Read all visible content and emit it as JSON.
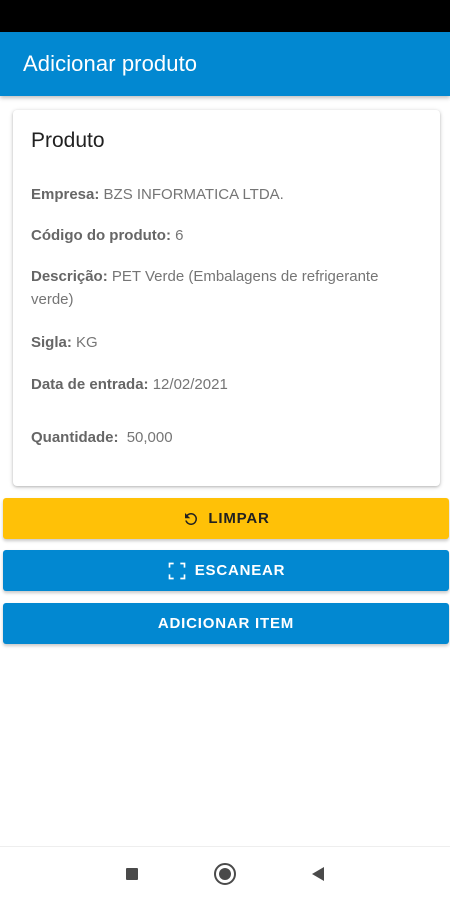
{
  "app_bar": {
    "title": "Adicionar produto"
  },
  "card": {
    "title": "Produto",
    "fields": {
      "empresa": {
        "label": "Empresa:",
        "value": "BZS INFORMATICA LTDA."
      },
      "codigo": {
        "label": "Código do produto:",
        "value": "6"
      },
      "descricao": {
        "label": "Descrição:",
        "value": "PET Verde (Embalagens de refrigerante verde)"
      },
      "sigla": {
        "label": "Sigla:",
        "value": "KG"
      },
      "data_entrada": {
        "label": "Data de entrada:",
        "value": "12/02/2021"
      },
      "quantidade": {
        "label": "Quantidade:",
        "value": "50,000"
      }
    }
  },
  "buttons": {
    "clear": {
      "label": "LIMPAR",
      "icon": "refresh-icon",
      "color": "#FFC107"
    },
    "scan": {
      "label": "ESCANEAR",
      "icon": "scan-frame-icon",
      "color": "#0288D1"
    },
    "add": {
      "label": "ADICIONAR ITEM",
      "color": "#0288D1"
    }
  },
  "nav_bar": {
    "icons": [
      "recents-square-icon",
      "home-circle-icon",
      "back-triangle-icon"
    ]
  },
  "colors": {
    "primary": "#0288D1",
    "accent": "#FFC107",
    "status_bar": "#000000"
  }
}
